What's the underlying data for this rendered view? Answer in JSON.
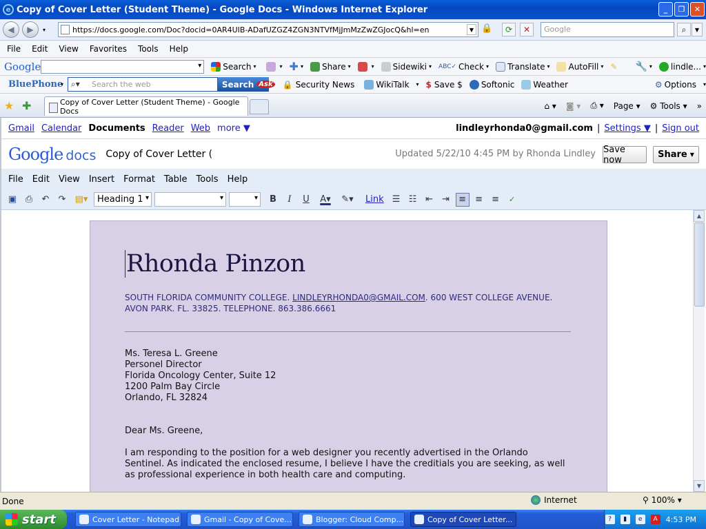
{
  "window": {
    "title": "Copy of Cover Letter (Student Theme) - Google Docs - Windows Internet Explorer"
  },
  "address_bar": {
    "url": "https://docs.google.com/Doc?docid=0AR4UIB-ADafUZGZ4ZGN3NTVfMjJmMzZwZGJocQ&hl=en",
    "search_placeholder": "Google"
  },
  "ie_menu": [
    "File",
    "Edit",
    "View",
    "Favorites",
    "Tools",
    "Help"
  ],
  "google_toolbar": {
    "logo": "Google",
    "items": [
      "Search",
      "Share",
      "Sidewiki",
      "Check",
      "Translate",
      "AutoFill",
      "lindle..."
    ]
  },
  "bluephone_toolbar": {
    "logo": "BluePhone",
    "search_placeholder": "Search the web",
    "search_button": "Search",
    "ask": "Ask",
    "items": [
      "Security News",
      "WikiTalk",
      "Save $",
      "Softonic",
      "Weather",
      "Options"
    ]
  },
  "tabs": {
    "active": "Copy of Cover Letter (Student Theme) - Google Docs"
  },
  "command_bar": {
    "page": "Page",
    "tools": "Tools"
  },
  "gbar": {
    "links": [
      "Gmail",
      "Calendar",
      "Documents",
      "Reader",
      "Web",
      "more ▼"
    ],
    "account": "lindleyrhonda0@gmail.com",
    "settings": "Settings ▼",
    "signout": "Sign out"
  },
  "doc_header": {
    "logo_google": "Google",
    "logo_docs": "docs",
    "title": "Copy of Cover Letter (St",
    "updated": "Updated 5/22/10 4:45 PM by Rhonda Lindley",
    "save": "Save now",
    "share": "Share"
  },
  "doc_menu": [
    "File",
    "Edit",
    "View",
    "Insert",
    "Format",
    "Table",
    "Tools",
    "Help"
  ],
  "doc_toolbar": {
    "style": "Heading 1",
    "font": "",
    "size": "",
    "link": "Link"
  },
  "document": {
    "name": "Rhonda Pinzon",
    "contact_pre": "SOUTH FLORIDA COMMUNITY COLLEGE. ",
    "contact_email": "LINDLEYRHONDA0@GMAIL.COM",
    "contact_post": ". 600 WEST COLLEGE AVENUE. AVON PARK. FL. 33825. TELEPHONE. 863.386.6661",
    "address": [
      "Ms. Teresa L. Greene",
      "Personel Director",
      "Florida Oncology Center, Suite 12",
      "1200 Palm Bay Circle",
      "Orlando, FL 32824"
    ],
    "salutation": "Dear Ms. Greene,",
    "paragraph": "I am responding to the position for a web designer you recently advertised in the Orlando Sentinel. As indicated the enclosed resume, I believe I have the creditials you are seeking, as well as professional experience in both health care and computing."
  },
  "status": {
    "text": "Done",
    "zone": "Internet",
    "zoom": "100%"
  },
  "taskbar": {
    "start": "start",
    "tasks": [
      "Cover Letter - Notepad",
      "Gmail - Copy of Cove...",
      "Blogger: Cloud Comp...",
      "Copy of Cover Letter..."
    ],
    "clock": "4:53 PM"
  }
}
